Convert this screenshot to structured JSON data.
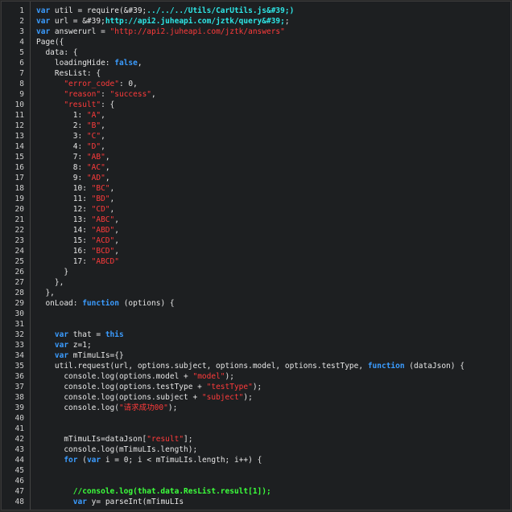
{
  "editor": {
    "lines": [
      {
        "n": "1",
        "tokens": [
          {
            "c": "kw",
            "t": "var"
          },
          {
            "c": "plain",
            "t": " util = require(&#39;"
          },
          {
            "c": "cyan",
            "t": "../../../Utils/CarUtils.js&#39;)"
          }
        ]
      },
      {
        "n": "2",
        "tokens": [
          {
            "c": "kw",
            "t": "var"
          },
          {
            "c": "plain",
            "t": " url = &#39;"
          },
          {
            "c": "cyan",
            "t": "http://api2.juheapi.com/jztk/query&#39;"
          },
          {
            "c": "plain",
            "t": ";"
          }
        ]
      },
      {
        "n": "3",
        "tokens": [
          {
            "c": "kw",
            "t": "var"
          },
          {
            "c": "plain",
            "t": " answerurl = "
          },
          {
            "c": "str",
            "t": "\"http://api2.juheapi.com/jztk/answers\""
          }
        ]
      },
      {
        "n": "4",
        "tokens": [
          {
            "c": "plain",
            "t": "Page({"
          }
        ]
      },
      {
        "n": "5",
        "tokens": [
          {
            "c": "plain",
            "t": "  data: {"
          }
        ]
      },
      {
        "n": "6",
        "tokens": [
          {
            "c": "plain",
            "t": "    loadingHide: "
          },
          {
            "c": "kw",
            "t": "false"
          },
          {
            "c": "plain",
            "t": ","
          }
        ]
      },
      {
        "n": "7",
        "tokens": [
          {
            "c": "plain",
            "t": "    ResList: {"
          }
        ]
      },
      {
        "n": "8",
        "tokens": [
          {
            "c": "plain",
            "t": "      "
          },
          {
            "c": "str",
            "t": "\"error_code\""
          },
          {
            "c": "plain",
            "t": ": 0,"
          }
        ]
      },
      {
        "n": "9",
        "tokens": [
          {
            "c": "plain",
            "t": "      "
          },
          {
            "c": "str",
            "t": "\"reason\""
          },
          {
            "c": "plain",
            "t": ": "
          },
          {
            "c": "str",
            "t": "\"success\""
          },
          {
            "c": "plain",
            "t": ","
          }
        ]
      },
      {
        "n": "10",
        "tokens": [
          {
            "c": "plain",
            "t": "      "
          },
          {
            "c": "str",
            "t": "\"result\""
          },
          {
            "c": "plain",
            "t": ": {"
          }
        ]
      },
      {
        "n": "11",
        "tokens": [
          {
            "c": "plain",
            "t": "        1: "
          },
          {
            "c": "str",
            "t": "\"A\""
          },
          {
            "c": "plain",
            "t": ","
          }
        ]
      },
      {
        "n": "12",
        "tokens": [
          {
            "c": "plain",
            "t": "        2: "
          },
          {
            "c": "str",
            "t": "\"B\""
          },
          {
            "c": "plain",
            "t": ","
          }
        ]
      },
      {
        "n": "13",
        "tokens": [
          {
            "c": "plain",
            "t": "        3: "
          },
          {
            "c": "str",
            "t": "\"C\""
          },
          {
            "c": "plain",
            "t": ","
          }
        ]
      },
      {
        "n": "14",
        "tokens": [
          {
            "c": "plain",
            "t": "        4: "
          },
          {
            "c": "str",
            "t": "\"D\""
          },
          {
            "c": "plain",
            "t": ","
          }
        ]
      },
      {
        "n": "15",
        "tokens": [
          {
            "c": "plain",
            "t": "        7: "
          },
          {
            "c": "str",
            "t": "\"AB\""
          },
          {
            "c": "plain",
            "t": ","
          }
        ]
      },
      {
        "n": "16",
        "tokens": [
          {
            "c": "plain",
            "t": "        8: "
          },
          {
            "c": "str",
            "t": "\"AC\""
          },
          {
            "c": "plain",
            "t": ","
          }
        ]
      },
      {
        "n": "17",
        "tokens": [
          {
            "c": "plain",
            "t": "        9: "
          },
          {
            "c": "str",
            "t": "\"AD\""
          },
          {
            "c": "plain",
            "t": ","
          }
        ]
      },
      {
        "n": "18",
        "tokens": [
          {
            "c": "plain",
            "t": "        10: "
          },
          {
            "c": "str",
            "t": "\"BC\""
          },
          {
            "c": "plain",
            "t": ","
          }
        ]
      },
      {
        "n": "19",
        "tokens": [
          {
            "c": "plain",
            "t": "        11: "
          },
          {
            "c": "str",
            "t": "\"BD\""
          },
          {
            "c": "plain",
            "t": ","
          }
        ]
      },
      {
        "n": "20",
        "tokens": [
          {
            "c": "plain",
            "t": "        12: "
          },
          {
            "c": "str",
            "t": "\"CD\""
          },
          {
            "c": "plain",
            "t": ","
          }
        ]
      },
      {
        "n": "21",
        "tokens": [
          {
            "c": "plain",
            "t": "        13: "
          },
          {
            "c": "str",
            "t": "\"ABC\""
          },
          {
            "c": "plain",
            "t": ","
          }
        ]
      },
      {
        "n": "22",
        "tokens": [
          {
            "c": "plain",
            "t": "        14: "
          },
          {
            "c": "str",
            "t": "\"ABD\""
          },
          {
            "c": "plain",
            "t": ","
          }
        ]
      },
      {
        "n": "23",
        "tokens": [
          {
            "c": "plain",
            "t": "        15: "
          },
          {
            "c": "str",
            "t": "\"ACD\""
          },
          {
            "c": "plain",
            "t": ","
          }
        ]
      },
      {
        "n": "24",
        "tokens": [
          {
            "c": "plain",
            "t": "        16: "
          },
          {
            "c": "str",
            "t": "\"BCD\""
          },
          {
            "c": "plain",
            "t": ","
          }
        ]
      },
      {
        "n": "25",
        "tokens": [
          {
            "c": "plain",
            "t": "        17: "
          },
          {
            "c": "str",
            "t": "\"ABCD\""
          }
        ]
      },
      {
        "n": "26",
        "tokens": [
          {
            "c": "plain",
            "t": "      }"
          }
        ]
      },
      {
        "n": "27",
        "tokens": [
          {
            "c": "plain",
            "t": "    },"
          }
        ]
      },
      {
        "n": "28",
        "tokens": [
          {
            "c": "plain",
            "t": "  },"
          }
        ]
      },
      {
        "n": "29",
        "tokens": [
          {
            "c": "plain",
            "t": "  onLoad: "
          },
          {
            "c": "kw",
            "t": "function"
          },
          {
            "c": "plain",
            "t": " (options) {"
          }
        ]
      },
      {
        "n": "30",
        "tokens": []
      },
      {
        "n": "31",
        "tokens": []
      },
      {
        "n": "32",
        "tokens": [
          {
            "c": "plain",
            "t": "    "
          },
          {
            "c": "kw",
            "t": "var"
          },
          {
            "c": "plain",
            "t": " that = "
          },
          {
            "c": "kw",
            "t": "this"
          }
        ]
      },
      {
        "n": "33",
        "tokens": [
          {
            "c": "plain",
            "t": "    "
          },
          {
            "c": "kw",
            "t": "var"
          },
          {
            "c": "plain",
            "t": " z=1;"
          }
        ]
      },
      {
        "n": "34",
        "tokens": [
          {
            "c": "plain",
            "t": "    "
          },
          {
            "c": "kw",
            "t": "var"
          },
          {
            "c": "plain",
            "t": " mTimuLIs={}"
          }
        ]
      },
      {
        "n": "35",
        "tokens": [
          {
            "c": "plain",
            "t": "    util.request(url, options.subject, options.model, options.testType, "
          },
          {
            "c": "kw",
            "t": "function"
          },
          {
            "c": "plain",
            "t": " (dataJson) {"
          }
        ]
      },
      {
        "n": "36",
        "tokens": [
          {
            "c": "plain",
            "t": "      console.log(options.model + "
          },
          {
            "c": "str",
            "t": "\"model\""
          },
          {
            "c": "plain",
            "t": ");"
          }
        ]
      },
      {
        "n": "37",
        "tokens": [
          {
            "c": "plain",
            "t": "      console.log(options.testType + "
          },
          {
            "c": "str",
            "t": "\"testType\""
          },
          {
            "c": "plain",
            "t": ");"
          }
        ]
      },
      {
        "n": "38",
        "tokens": [
          {
            "c": "plain",
            "t": "      console.log(options.subject + "
          },
          {
            "c": "str",
            "t": "\"subject\""
          },
          {
            "c": "plain",
            "t": ");"
          }
        ]
      },
      {
        "n": "39",
        "tokens": [
          {
            "c": "plain",
            "t": "      console.log("
          },
          {
            "c": "str",
            "t": "\"请求成功00\""
          },
          {
            "c": "plain",
            "t": ");"
          }
        ]
      },
      {
        "n": "40",
        "tokens": []
      },
      {
        "n": "41",
        "tokens": []
      },
      {
        "n": "42",
        "tokens": [
          {
            "c": "plain",
            "t": "      mTimuLIs=dataJson["
          },
          {
            "c": "str",
            "t": "\"result\""
          },
          {
            "c": "plain",
            "t": "];"
          }
        ]
      },
      {
        "n": "43",
        "tokens": [
          {
            "c": "plain",
            "t": "      console.log(mTimuLIs.length);"
          }
        ]
      },
      {
        "n": "44",
        "tokens": [
          {
            "c": "plain",
            "t": "      "
          },
          {
            "c": "kw",
            "t": "for"
          },
          {
            "c": "plain",
            "t": " ("
          },
          {
            "c": "kw",
            "t": "var"
          },
          {
            "c": "plain",
            "t": " i = 0; i < mTimuLIs.length; i++) {"
          }
        ]
      },
      {
        "n": "45",
        "tokens": []
      },
      {
        "n": "46",
        "tokens": []
      },
      {
        "n": "47",
        "tokens": [
          {
            "c": "plain",
            "t": "        "
          },
          {
            "c": "cmt",
            "t": "//console.log(that.data.ResList.result[1]);"
          }
        ]
      },
      {
        "n": "48",
        "tokens": [
          {
            "c": "plain",
            "t": "        "
          },
          {
            "c": "kw",
            "t": "var"
          },
          {
            "c": "plain",
            "t": " y= parseInt(mTimuLIs"
          }
        ]
      }
    ]
  },
  "colors": {
    "background": "#1d1f21",
    "keyword": "#3b9cff",
    "string": "#ff3b3b",
    "cyan_text": "#2ee6e6",
    "comment": "#3cff3c",
    "plain_text": "#e6e6e6",
    "line_number": "#cfcfcf"
  }
}
